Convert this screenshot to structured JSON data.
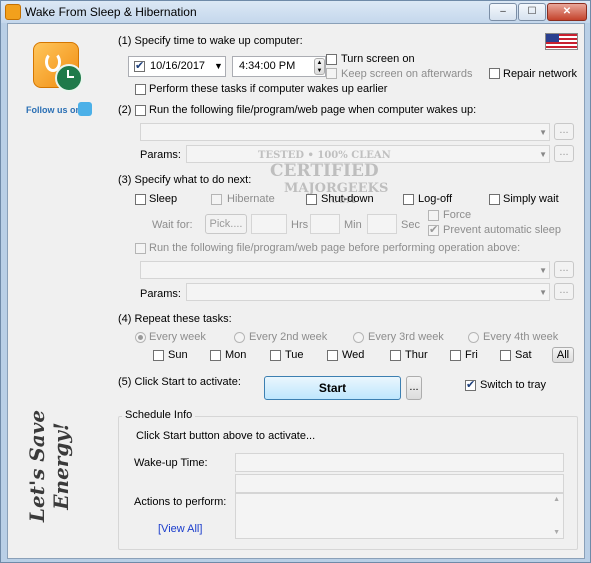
{
  "window": {
    "title": "Wake From Sleep & Hibernation",
    "controls": {
      "minimize": "–",
      "maximize": "☐",
      "close": "✕"
    }
  },
  "sidebar": {
    "follow_us": "Follow us on",
    "slogan": "Let's Save Energy!"
  },
  "section1": {
    "label": "(1) Specify time to wake up computer:",
    "date_value": "10/16/2017",
    "time_value": "4:34:00 PM",
    "turn_screen_on": "Turn screen on",
    "keep_screen_on": "Keep screen on afterwards",
    "repair_network": "Repair network",
    "perform_earlier": "Perform these tasks if computer wakes up earlier"
  },
  "section2": {
    "label": "(2) Run the following file/program/web page when computer wakes up:",
    "params_label": "Params:",
    "browse_label": "..."
  },
  "section3": {
    "label": "(3) Specify what to do next:",
    "options": {
      "sleep": "Sleep",
      "hibernate": "Hibernate",
      "shutdown": "Shut-down",
      "logoff": "Log-off",
      "simply_wait": "Simply wait"
    },
    "wait_for": "Wait for:",
    "pick": "Pick....",
    "hrs": "Hrs",
    "min": "Min",
    "sec": "Sec",
    "force": "Force",
    "prevent_sleep": "Prevent automatic sleep",
    "run_before": "Run the following file/program/web page before performing operation above:",
    "params_label": "Params:",
    "browse_label": "..."
  },
  "section4": {
    "label": "(4) Repeat these tasks:",
    "frequency": [
      "Every week",
      "Every 2nd week",
      "Every 3rd week",
      "Every 4th week"
    ],
    "days": [
      "Sun",
      "Mon",
      "Tue",
      "Wed",
      "Thur",
      "Fri",
      "Sat"
    ],
    "all": "All"
  },
  "section5": {
    "label": "(5) Click Start to activate:",
    "start": "Start",
    "more": "...",
    "switch_to_tray": "Switch to tray"
  },
  "schedule": {
    "title": "Schedule Info",
    "hint": "Click Start button above to activate...",
    "wake_up_time": "Wake-up Time:",
    "actions": "Actions to perform:",
    "view_all": "[View All]"
  },
  "watermark": {
    "line1": "TESTED • 100% CLEAN",
    "line2": "CERTIFIED",
    "line3": "MAJORGEEKS",
    "line4": ".COM"
  },
  "colors": {
    "accent_link": "#1a3ccc",
    "title_bar": "#c4d7ec",
    "start_button": "#bee6fd"
  }
}
